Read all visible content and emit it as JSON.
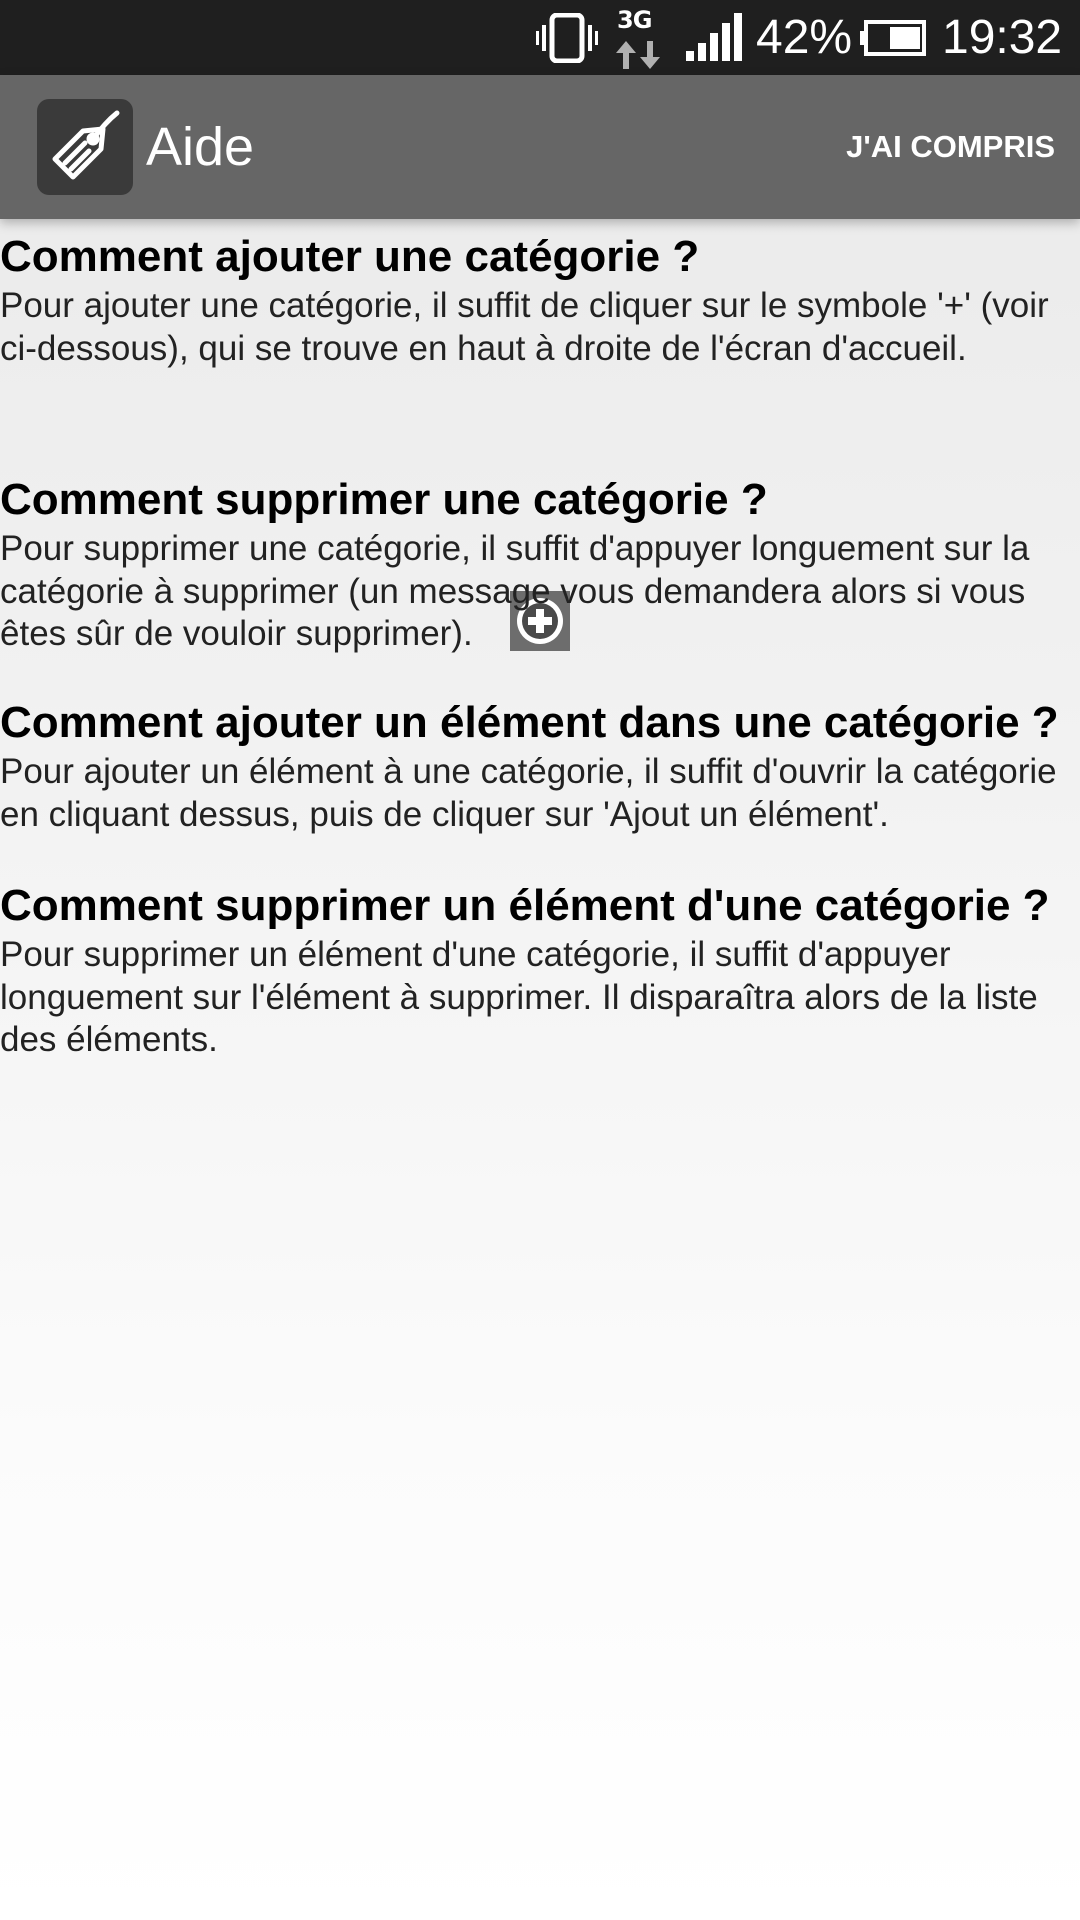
{
  "status_bar": {
    "network_type": "3G",
    "battery_percent": "42%",
    "time": "19:32",
    "icons": [
      "vibrate-icon",
      "network-3g-icon",
      "signal-icon",
      "battery-icon"
    ]
  },
  "action_bar": {
    "title": "Aide",
    "button_label": "J'AI COMPRIS",
    "app_icon": "tag-icon"
  },
  "sections": [
    {
      "title": "Comment ajouter une catégorie ?",
      "text": "Pour ajouter une catégorie, il suffit de cliquer sur le symbole '+' (voir ci-dessous), qui se trouve en haut à droite de l'écran d'accueil."
    },
    {
      "title": "Comment supprimer une catégorie ?",
      "text": "Pour supprimer une catégorie, il suffit d'appuyer longuement sur la catégorie à supprimer (un message vous demandera alors si vous êtes sûr de vouloir supprimer)."
    },
    {
      "title": "Comment ajouter un élément dans une catégorie ?",
      "text": "Pour ajouter un élément à une catégorie, il suffit d'ouvrir la catégorie en cliquant dessus, puis de cliquer sur 'Ajout un élément'."
    },
    {
      "title": "Comment supprimer un élément d'une catégorie ?",
      "text": "Pour supprimer un élément d'une catégorie, il suffit d'appuyer longuement sur l'élément à supprimer. Il disparaîtra alors de la liste des éléments."
    }
  ],
  "illustration_icon": "add-circle-icon",
  "colors": {
    "status_bar": "#1f1f1f",
    "action_bar": "#666666",
    "app_icon_bg": "#3a3a3a"
  }
}
